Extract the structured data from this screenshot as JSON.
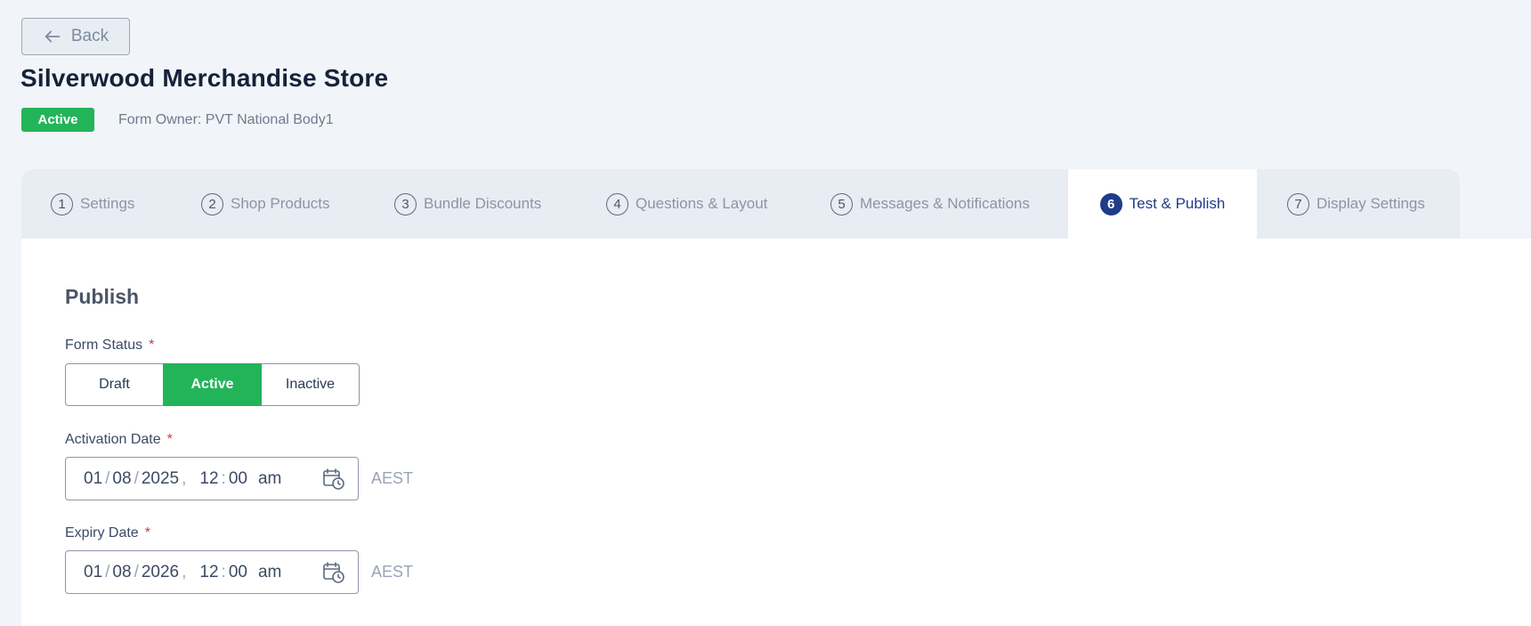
{
  "back_button": {
    "label": "Back",
    "icon": "arrow-left-icon"
  },
  "page": {
    "title": "Silverwood Merchandise Store"
  },
  "status": {
    "badge": "Active",
    "badge_color": "#23b45a"
  },
  "owner": {
    "label": "Form Owner:",
    "value": "PVT National Body1"
  },
  "tabs": [
    {
      "number": "1",
      "label": "Settings"
    },
    {
      "number": "2",
      "label": "Shop Products"
    },
    {
      "number": "3",
      "label": "Bundle Discounts"
    },
    {
      "number": "4",
      "label": "Questions & Layout"
    },
    {
      "number": "5",
      "label": "Messages & Notifications"
    },
    {
      "number": "6",
      "label": "Test & Publish",
      "active": true
    },
    {
      "number": "7",
      "label": "Display Settings"
    }
  ],
  "publish": {
    "title": "Publish",
    "form_status": {
      "label": "Form Status",
      "required_mark": "*",
      "options": [
        "Draft",
        "Active",
        "Inactive"
      ],
      "selected": "Active"
    },
    "activation_date": {
      "label": "Activation Date",
      "required_mark": "*",
      "day": "01",
      "month": "08",
      "year": "2025",
      "hour": "12",
      "minute": "00",
      "ampm": "am",
      "timezone": "AEST",
      "icon": "calendar-clock-icon"
    },
    "expiry_date": {
      "label": "Expiry Date",
      "required_mark": "*",
      "day": "01",
      "month": "08",
      "year": "2026",
      "hour": "12",
      "minute": "00",
      "ampm": "am",
      "timezone": "AEST",
      "icon": "calendar-clock-icon"
    }
  },
  "colors": {
    "accent": "#1f3c88",
    "success": "#23b45a",
    "required": "#e03131"
  }
}
